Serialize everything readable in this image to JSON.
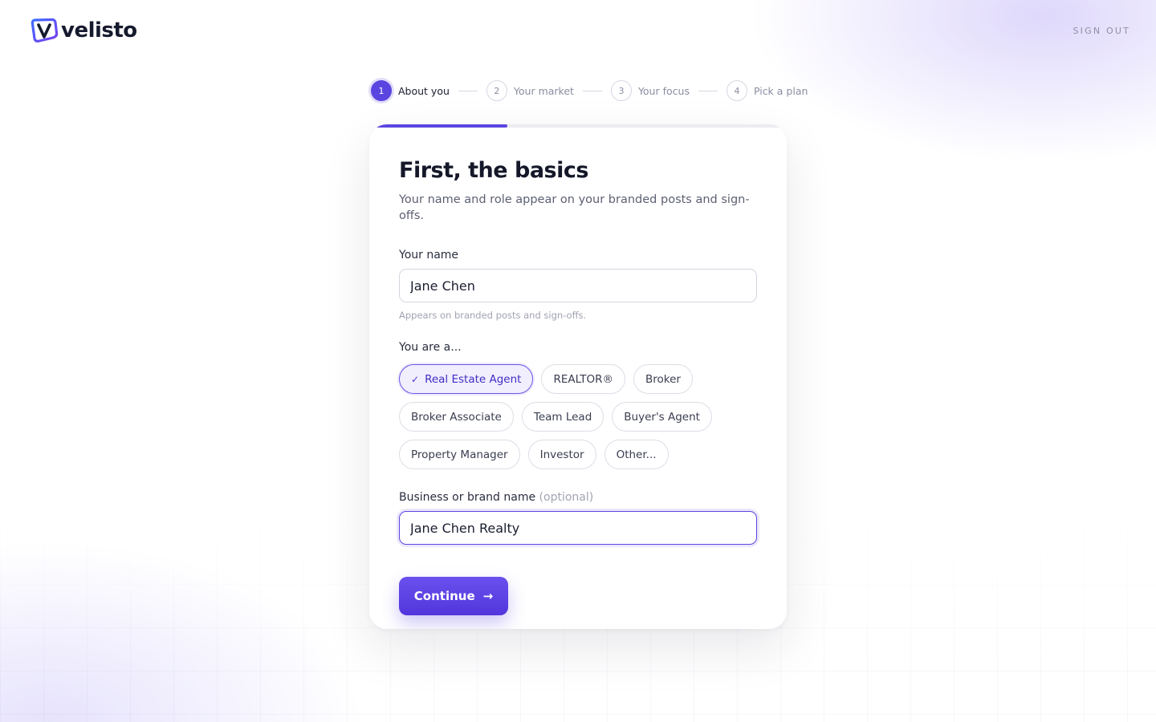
{
  "brand": {
    "logo_text": "velisto",
    "accent_color": "#5b45e0"
  },
  "header": {
    "sign_out_label": "SIGN OUT"
  },
  "stepper": {
    "current_step": 1,
    "steps": [
      {
        "number": "1",
        "label": "About you",
        "state": "active"
      },
      {
        "number": "2",
        "label": "Your market",
        "state": "upcoming"
      },
      {
        "number": "3",
        "label": "Your focus",
        "state": "upcoming"
      },
      {
        "number": "4",
        "label": "Pick a plan",
        "state": "upcoming"
      }
    ],
    "progress_fraction": 0.33
  },
  "form": {
    "title": "First, the basics",
    "subtitle": "Your name and role appear on your branded posts and sign-offs.",
    "name_field": {
      "label": "Your name",
      "value": "Jane Chen",
      "hint": "Appears on branded posts and sign-offs."
    },
    "role_field": {
      "label": "You are a...",
      "selected": "Real Estate Agent",
      "options": [
        "Real Estate Agent",
        "REALTOR®",
        "Broker",
        "Broker Associate",
        "Team Lead",
        "Buyer's Agent",
        "Property Manager",
        "Investor",
        "Other..."
      ]
    },
    "business_field": {
      "label": "Business or brand name",
      "optional_label": "(optional)",
      "value": "Jane Chen Realty"
    },
    "continue_label": "Continue",
    "continue_icon": "arrow-right-icon"
  }
}
